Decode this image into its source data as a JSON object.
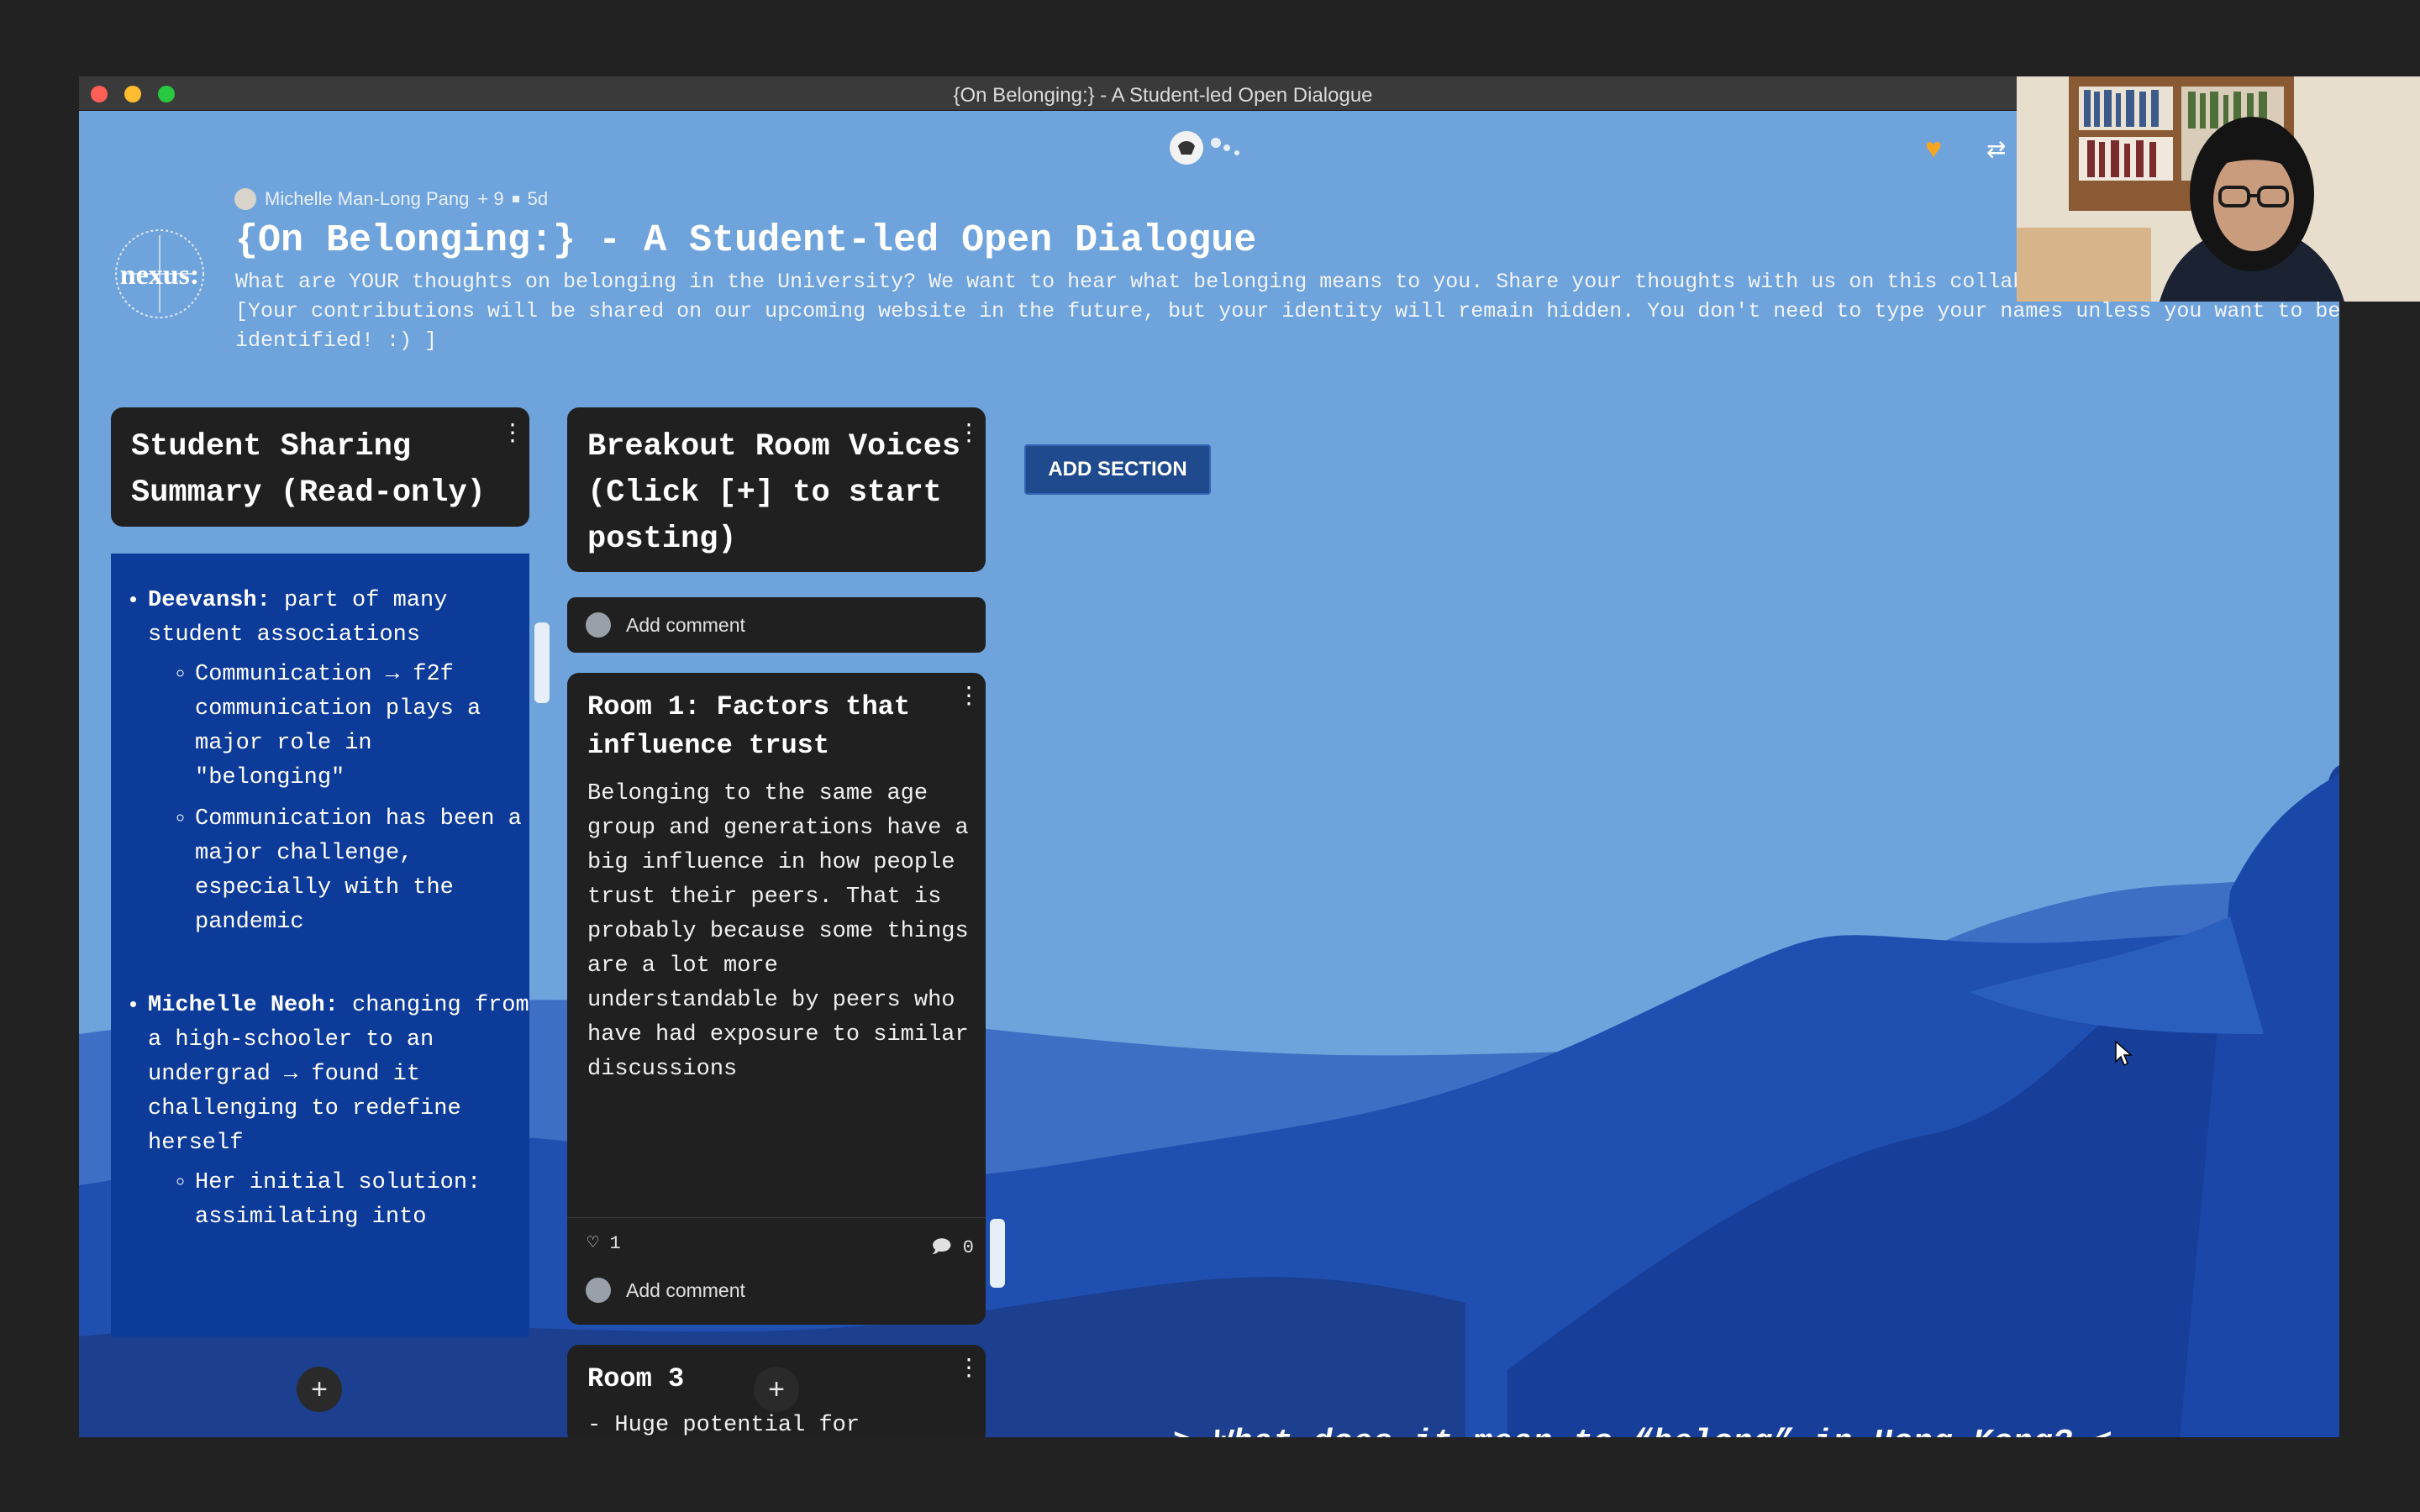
{
  "window": {
    "title": "{On Belonging:} - A Student-led Open Dialogue"
  },
  "board": {
    "author": "Michelle Man-Long Pang",
    "collaborators": "+ 9",
    "age": "5d",
    "logo_text": "nexus:",
    "title": "{On Belonging:} - A Student-led Open Dialogue",
    "description": "What are YOUR thoughts on belonging in the University? We want to hear what belonging means to you. Share your thoughts with us on this collaborative Padlet board! // [Your contributions will be shared on our upcoming website in the future, but your identity will remain hidden. You don't need to type your names unless you want to be identified! :) ]"
  },
  "columns": [
    {
      "title": "Student Sharing Summary (Read-only)",
      "summary": {
        "d_name": "Deevansh:",
        "d_text": " part of many student associations",
        "d_sub1": "Communication → f2f communication plays a major role in \"belonging\"",
        "d_sub2": "Communication has been a major challenge, especially with the pandemic",
        "m_name": "Michelle Neoh:",
        "m_text": " changing from a high-schooler to an undergrad → found it challenging to redefine herself",
        "m_sub1": "Her initial solution: assimilating into"
      }
    },
    {
      "title": "Breakout Room Voices (Click [+] to start posting)",
      "add_comment": "Add comment",
      "posts": [
        {
          "title": "Room 1: Factors that influence trust",
          "body": "Belonging to the same age group and generations have a big influence in how people trust their peers. That is probably because some things are a lot more understandable by peers who have had exposure to similar discussions",
          "likes": "1",
          "comments": "0",
          "add_comment": "Add comment"
        },
        {
          "title": "Room 3",
          "body": "- Huge potential for"
        }
      ]
    }
  ],
  "add_section_label": "ADD SECTION",
  "plus_label": "+",
  "tagline": "> What does it mean to “belong” in Hong Kong? <",
  "icons": {
    "heart": "heart-icon",
    "share": "remix-icon",
    "kebab": "kebab-menu-icon",
    "like": "heart-outline-icon",
    "comment": "comment-icon"
  },
  "colors": {
    "board_bg": "#6fa3dc",
    "card_bg": "#202020",
    "summary_bg": "#0d3b9a",
    "accent_heart": "#f5a623"
  }
}
